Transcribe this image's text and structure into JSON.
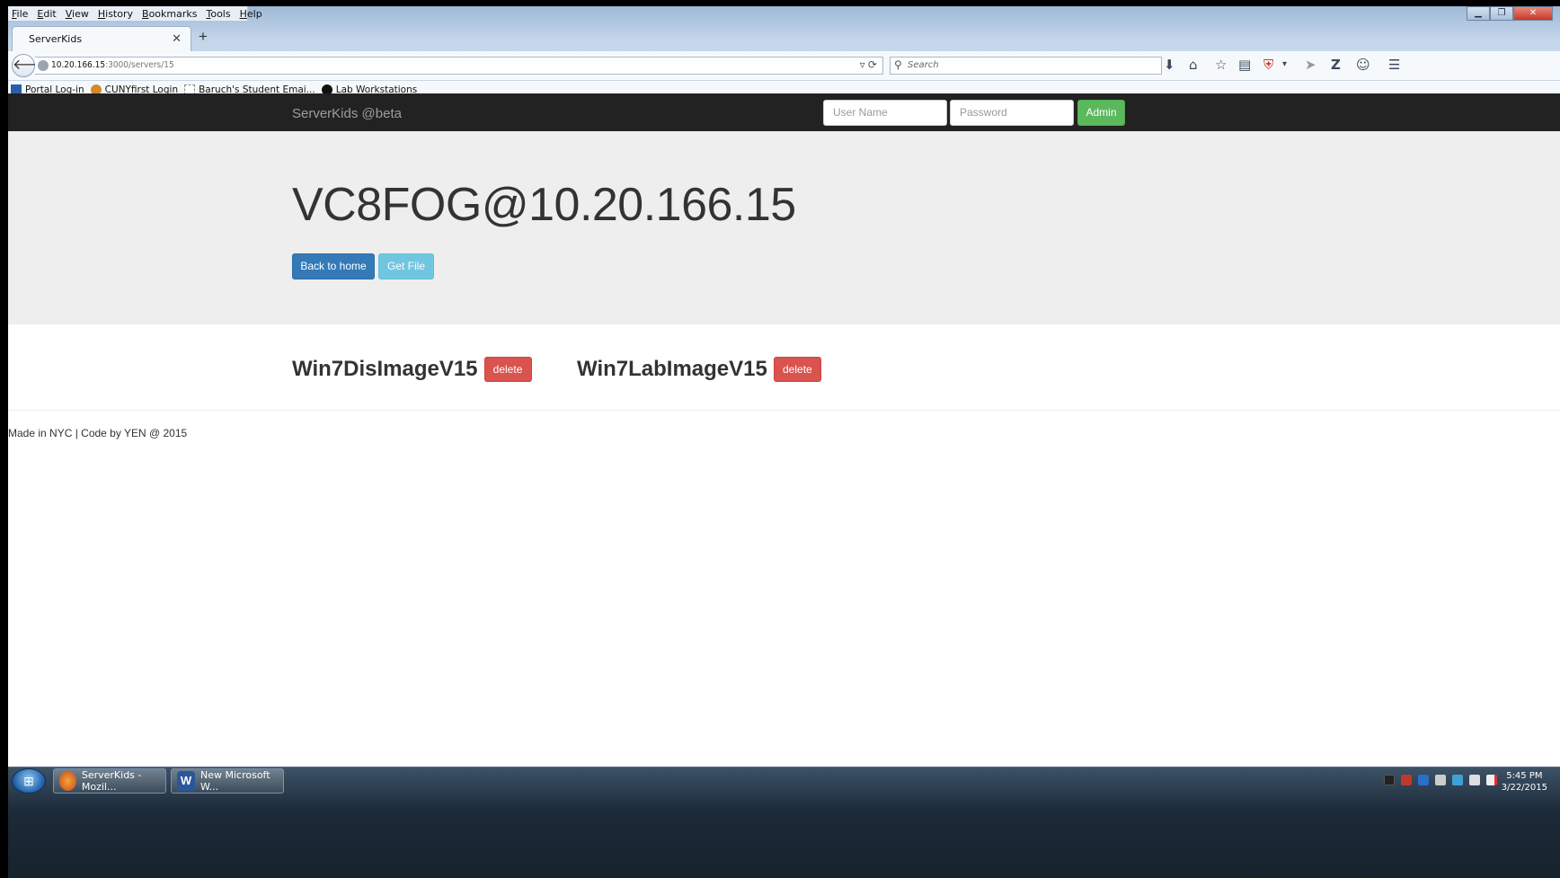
{
  "browser": {
    "menu": [
      "File",
      "Edit",
      "View",
      "History",
      "Bookmarks",
      "Tools",
      "Help"
    ],
    "tab_title": "ServerKids",
    "new_tab": "+",
    "url_host": "10.20.166.15",
    "url_path": ":3000/servers/15",
    "search_placeholder": "Search",
    "bookmarks": [
      {
        "label": "Portal Log-in",
        "color": "#2a5ea8"
      },
      {
        "label": "CUNYfirst Login",
        "color": "#d18a2c"
      },
      {
        "label": "Baruch's Student Emai...",
        "color": "#ffffff"
      },
      {
        "label": "Lab Workstations",
        "color": "#111111"
      }
    ]
  },
  "site": {
    "brand": "ServerKids @beta",
    "username_placeholder": "User Name",
    "password_placeholder": "Password",
    "admin_label": "Admin",
    "server_title": "VC8FOG@10.20.166.15",
    "back_home_label": "Back to home",
    "get_file_label": "Get File",
    "images": [
      {
        "name": "Win7DisImageV15",
        "action": "delete"
      },
      {
        "name": "Win7LabImageV15",
        "action": "delete"
      }
    ],
    "footer": "Made in NYC | Code by YEN @ 2015"
  },
  "taskbar": {
    "tasks": [
      {
        "label": "ServerKids - Mozil...",
        "icon": "firefox-icon"
      },
      {
        "label": "New Microsoft W...",
        "icon": "word-icon"
      }
    ],
    "time": "5:45 PM",
    "date": "3/22/2015"
  },
  "colors": {
    "navbar": "#222222",
    "jumbotron": "#eeeeee",
    "primary": "#337ab7",
    "info": "#5bc0de",
    "success": "#5cb85c",
    "danger": "#d9534f"
  }
}
